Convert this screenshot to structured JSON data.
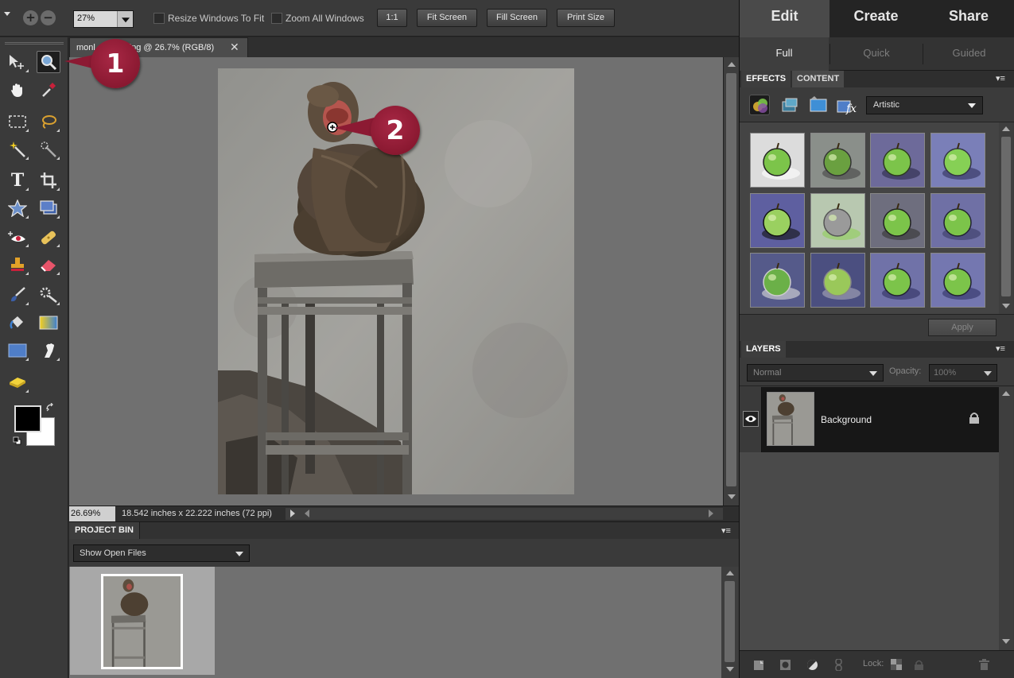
{
  "options_bar": {
    "zoom_value": "27%",
    "resize_windows_label": "Resize Windows To Fit",
    "zoom_all_label": "Zoom All Windows",
    "btn_1to1": "1:1",
    "btn_fit_screen": "Fit Screen",
    "btn_fill_screen": "Fill Screen",
    "btn_print_size": "Print Size"
  },
  "document": {
    "tab_title": "monl             .jpg @ 26.7% (RGB/8)",
    "status_zoom": "26.69%",
    "status_info": "18.542 inches x 22.222 inches (72 ppi)"
  },
  "project_bin": {
    "title": "PROJECT BIN",
    "show_label": "Show Open Files"
  },
  "mode_tabs": [
    "Edit",
    "Create",
    "Share"
  ],
  "sub_tabs": [
    "Full",
    "Quick",
    "Guided"
  ],
  "effects": {
    "tab_effects": "EFFECTS",
    "tab_content": "CONTENT",
    "category": "Artistic",
    "apply_label": "Apply"
  },
  "layers": {
    "title": "LAYERS",
    "blend_mode": "Normal",
    "opacity_label": "Opacity:",
    "opacity_value": "100%",
    "layer_name": "Background",
    "lock_label": "Lock:"
  },
  "callouts": [
    "1",
    "2"
  ],
  "colors": {
    "callout": "#8c1a33",
    "foreground": "#000000",
    "background": "#ffffff",
    "effect_green": "#7cc44a"
  }
}
